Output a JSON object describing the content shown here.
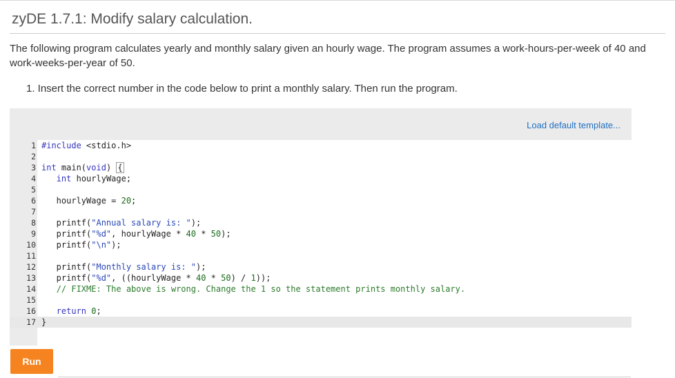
{
  "title": "zyDE 1.7.1: Modify salary calculation.",
  "description": "The following program calculates yearly and monthly salary given an hourly wage. The program assumes a work-hours-per-week of 40 and work-weeks-per-year of 50.",
  "instructions": [
    "1. Insert the correct number in the code below to print a monthly salary. Then run the program."
  ],
  "load_template_label": "Load default template...",
  "run_label": "Run",
  "accent_color": "#f5831f",
  "link_color": "#1f70c1",
  "active_line": 17,
  "code_lines": [
    {
      "num": "1",
      "text": "#include <stdio.h>"
    },
    {
      "num": "2",
      "text": ""
    },
    {
      "num": "3",
      "text": "int main(void) {"
    },
    {
      "num": "4",
      "text": "   int hourlyWage;"
    },
    {
      "num": "5",
      "text": ""
    },
    {
      "num": "6",
      "text": "   hourlyWage = 20;"
    },
    {
      "num": "7",
      "text": ""
    },
    {
      "num": "8",
      "text": "   printf(\"Annual salary is: \");"
    },
    {
      "num": "9",
      "text": "   printf(\"%d\", hourlyWage * 40 * 50);"
    },
    {
      "num": "10",
      "text": "   printf(\"\\n\");"
    },
    {
      "num": "11",
      "text": ""
    },
    {
      "num": "12",
      "text": "   printf(\"Monthly salary is: \");"
    },
    {
      "num": "13",
      "text": "   printf(\"%d\", ((hourlyWage * 40 * 50) / 1));"
    },
    {
      "num": "14",
      "text": "   // FIXME: The above is wrong. Change the 1 so the statement prints monthly salary."
    },
    {
      "num": "15",
      "text": ""
    },
    {
      "num": "16",
      "text": "   return 0;"
    },
    {
      "num": "17",
      "text": "}"
    }
  ]
}
